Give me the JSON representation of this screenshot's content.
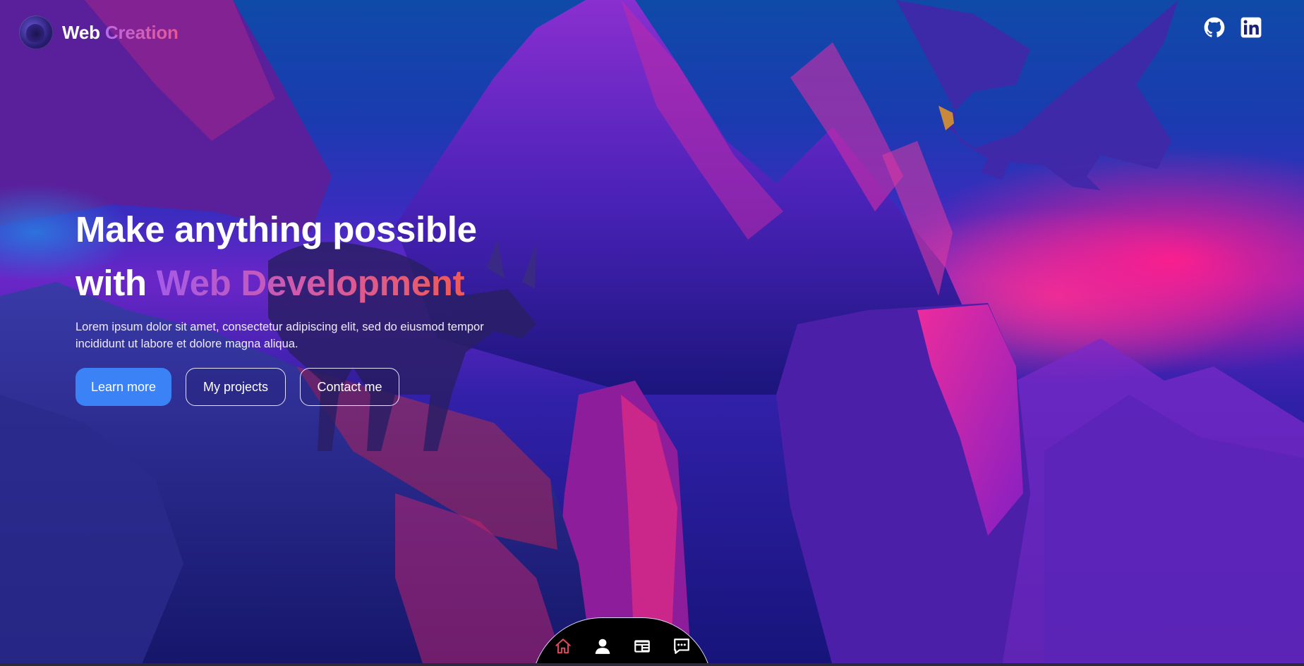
{
  "brand": {
    "name_part1": "Web",
    "name_part2": "Creation",
    "logo_icon": "wolf-avatar"
  },
  "socials": [
    {
      "icon": "github-icon"
    },
    {
      "icon": "linkedin-icon"
    }
  ],
  "hero": {
    "title_line1": "Make anything possible",
    "title_line2_prefix": "with",
    "title_line2_highlight": "Web Development",
    "description": "Lorem ipsum dolor sit amet, consectetur adipiscing elit, sed do eiusmod tempor incididunt ut labore et dolore magna aliqua.",
    "buttons": {
      "learn_more": "Learn more",
      "my_projects": "My projects",
      "contact_me": "Contact me"
    }
  },
  "dock": {
    "items": [
      {
        "icon": "home-icon",
        "active": true
      },
      {
        "icon": "user-icon",
        "active": false
      },
      {
        "icon": "projects-icon",
        "active": false
      },
      {
        "icon": "chat-icon",
        "active": false
      }
    ]
  },
  "colors": {
    "accent_blue": "#3b82f6",
    "gradient_start": "#a45be6",
    "gradient_end": "#f05a55",
    "active_icon": "#e34a63"
  }
}
